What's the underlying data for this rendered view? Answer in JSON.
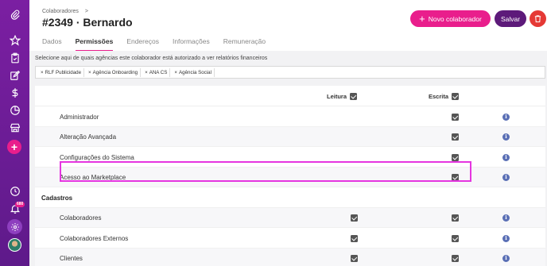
{
  "sidebar": {
    "icons": [
      "paperclip-icon",
      "star-icon",
      "clipboard-check-icon",
      "edit-icon",
      "dollar-icon",
      "pie-chart-icon",
      "store-icon",
      "add-icon",
      "clock-icon",
      "bell-icon",
      "gear-icon",
      "avatar"
    ],
    "notification_count": "680"
  },
  "header": {
    "breadcrumb": "Colaboradores",
    "breadcrumb_separator": ">",
    "title": "#2349 · Bernardo",
    "new_button_label": "Novo colaborador",
    "save_button_label": "Salvar"
  },
  "tabs": [
    {
      "label": "Dados",
      "active": false
    },
    {
      "label": "Permissões",
      "active": true
    },
    {
      "label": "Endereços",
      "active": false
    },
    {
      "label": "Informações",
      "active": false
    },
    {
      "label": "Remuneração",
      "active": false
    }
  ],
  "agencies": {
    "hint": "Selecione aqui de quais agências este colaborador está autorizado a ver relatórios financeiros",
    "selected": [
      "RLF Publicidade",
      "Agência Onboarding",
      "ANA CS",
      "Agência Social"
    ]
  },
  "permissions": {
    "read_header": "Leitura",
    "write_header": "Escrita",
    "rows": [
      {
        "label": "Administrador",
        "read": false,
        "write": true
      },
      {
        "label": "Alteração Avançada",
        "read": false,
        "write": true,
        "highlighted": true
      },
      {
        "label": "Configurações do Sistema",
        "read": false,
        "write": true
      },
      {
        "label": "Acesso ao Marketplace",
        "read": false,
        "write": true
      }
    ],
    "group": "Cadastros",
    "group_rows": [
      {
        "label": "Colaboradores",
        "read": true,
        "write": true
      },
      {
        "label": "Colaboradores Externos",
        "read": true,
        "write": true
      },
      {
        "label": "Clientes",
        "read": true,
        "write": true
      }
    ]
  },
  "colors": {
    "sidebar": "#6a1b9a",
    "accent": "#e91e8c",
    "save": "#5d1a7a",
    "delete": "#e53935",
    "highlight": "#e535e0"
  }
}
